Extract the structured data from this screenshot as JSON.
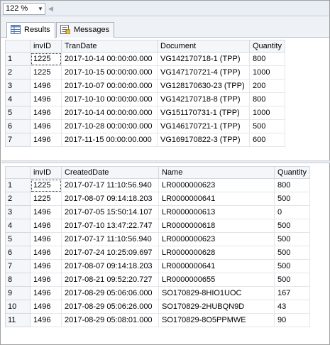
{
  "zoom": {
    "value": "122 %"
  },
  "tabs": [
    {
      "label": "Results",
      "icon": "grid-results-icon"
    },
    {
      "label": "Messages",
      "icon": "messages-icon"
    }
  ],
  "grid1": {
    "columns": [
      "invID",
      "TranDate",
      "Document",
      "Quantity"
    ],
    "rows": [
      [
        "1",
        "1225",
        "2017-10-14 00:00:00.000",
        "VG142170718-1 (TPP)",
        "800"
      ],
      [
        "2",
        "1225",
        "2017-10-15 00:00:00.000",
        "VG147170721-4 (TPP)",
        "1000"
      ],
      [
        "3",
        "1496",
        "2017-10-07 00:00:00.000",
        "VG128170630-23 (TPP)",
        "200"
      ],
      [
        "4",
        "1496",
        "2017-10-10 00:00:00.000",
        "VG142170718-8 (TPP)",
        "800"
      ],
      [
        "5",
        "1496",
        "2017-10-14 00:00:00.000",
        "VG151170731-1 (TPP)",
        "1000"
      ],
      [
        "6",
        "1496",
        "2017-10-28 00:00:00.000",
        "VG146170721-1 (TPP)",
        "500"
      ],
      [
        "7",
        "1496",
        "2017-11-15 00:00:00.000",
        "VG169170822-3 (TPP)",
        "600"
      ]
    ]
  },
  "grid2": {
    "columns": [
      "invID",
      "CreatedDate",
      "Name",
      "Quantity"
    ],
    "rows": [
      [
        "1",
        "1225",
        "2017-07-17 11:10:56.940",
        "LR0000000623",
        "800"
      ],
      [
        "2",
        "1225",
        "2017-08-07 09:14:18.203",
        "LR0000000641",
        "500"
      ],
      [
        "3",
        "1496",
        "2017-07-05 15:50:14.107",
        "LR0000000613",
        "0"
      ],
      [
        "4",
        "1496",
        "2017-07-10 13:47:22.747",
        "LR0000000618",
        "500"
      ],
      [
        "5",
        "1496",
        "2017-07-17 11:10:56.940",
        "LR0000000623",
        "500"
      ],
      [
        "6",
        "1496",
        "2017-07-24 10:25:09.697",
        "LR0000000628",
        "500"
      ],
      [
        "7",
        "1496",
        "2017-08-07 09:14:18.203",
        "LR0000000641",
        "500"
      ],
      [
        "8",
        "1496",
        "2017-08-21 09:52:20.727",
        "LR0000000655",
        "500"
      ],
      [
        "9",
        "1496",
        "2017-08-29 05:06:06.000",
        "SO170829-8HIO1UOC",
        "167"
      ],
      [
        "10",
        "1496",
        "2017-08-29 05:06:26.000",
        "SO170829-2HUBQN9D",
        "43"
      ],
      [
        "11",
        "1496",
        "2017-08-29 05:08:01.000",
        "SO170829-8O5PPMWE",
        "90"
      ]
    ]
  }
}
